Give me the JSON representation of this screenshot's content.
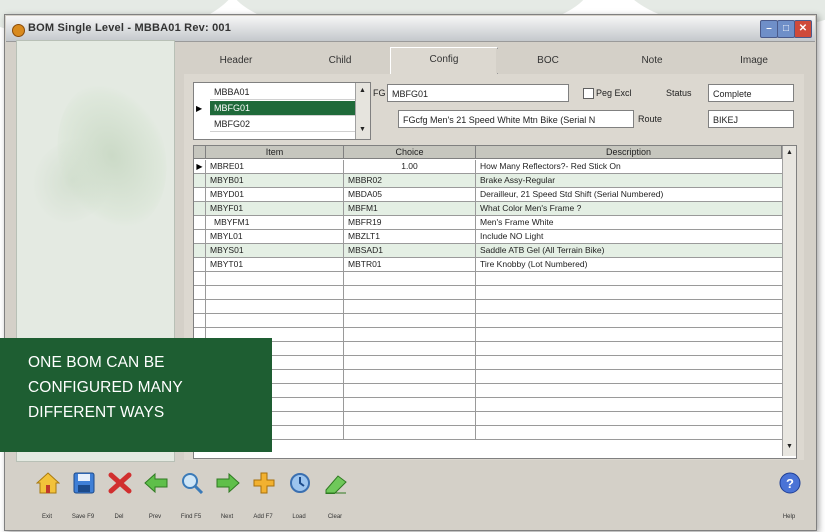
{
  "window": {
    "title": "BOM Single Level - MBBA01 Rev: 001",
    "controls": [
      "–",
      "□",
      "✕"
    ]
  },
  "tabs": [
    {
      "label": "Header"
    },
    {
      "label": "Child"
    },
    {
      "label": "Config"
    },
    {
      "label": "BOC"
    },
    {
      "label": "Note"
    },
    {
      "label": "Image"
    }
  ],
  "config_options": {
    "items": [
      "MBBA01",
      "MBFG01",
      "MBFG02"
    ],
    "selected_index": 1
  },
  "fields": {
    "fg_label": "FG",
    "fg_value": "MBFG01",
    "peg_label": "Peg Excl",
    "status_label": "Status",
    "status_value": "Complete",
    "description_value": "FGcfg Men's 21 Speed White Mtn Bike (Serial N",
    "route_label": "Route",
    "route_value": "BIKEJ"
  },
  "grid": {
    "headers": [
      "Item",
      "Choice",
      "Description"
    ],
    "rows": [
      {
        "item": "MBRE01",
        "choice": "1.00",
        "description": "How Many Reflectors?- Red Stick On"
      },
      {
        "item": "MBYB01",
        "choice": "MBBR02",
        "description": "Brake Assy-Regular"
      },
      {
        "item": "MBYD01",
        "choice": "MBDA05",
        "description": "Derailleur, 21 Speed Std Shift (Serial Numbered)"
      },
      {
        "item": "MBYF01",
        "choice": "MBFM1",
        "description": "What Color Men's Frame ?"
      },
      {
        "item": "MBYFM1",
        "choice": "MBFR19",
        "description": "Men's Frame White"
      },
      {
        "item": "MBYL01",
        "choice": "MBZLT1",
        "description": "Include NO Light"
      },
      {
        "item": "MBYS01",
        "choice": "MBSAD1",
        "description": "Saddle ATB Gel (All Terrain Bike)"
      },
      {
        "item": "MBYT01",
        "choice": "MBTR01",
        "description": "Tire Knobby (Lot Numbered)"
      }
    ],
    "selected_row": 0
  },
  "toolbar": [
    {
      "label": "Exit",
      "icon": "home-icon"
    },
    {
      "label": "Save F9",
      "icon": "save-icon"
    },
    {
      "label": "Del",
      "icon": "delete-icon"
    },
    {
      "label": "Prev",
      "icon": "arrow-left-icon"
    },
    {
      "label": "Find F5",
      "icon": "search-icon"
    },
    {
      "label": "Next",
      "icon": "arrow-right-icon"
    },
    {
      "label": "Add F7",
      "icon": "add-icon"
    },
    {
      "label": "Load",
      "icon": "load-icon"
    },
    {
      "label": "Clear",
      "icon": "clear-icon"
    },
    {
      "label": "Help",
      "icon": "help-icon"
    }
  ],
  "banner": {
    "line1": "ONE BOM CAN BE",
    "line2": "CONFIGURED MANY",
    "line3": "DIFFERENT WAYS"
  },
  "colors": {
    "banner": "#1e5e32",
    "selection": "#1f6a3a",
    "row_alt": "#e4efe4"
  }
}
